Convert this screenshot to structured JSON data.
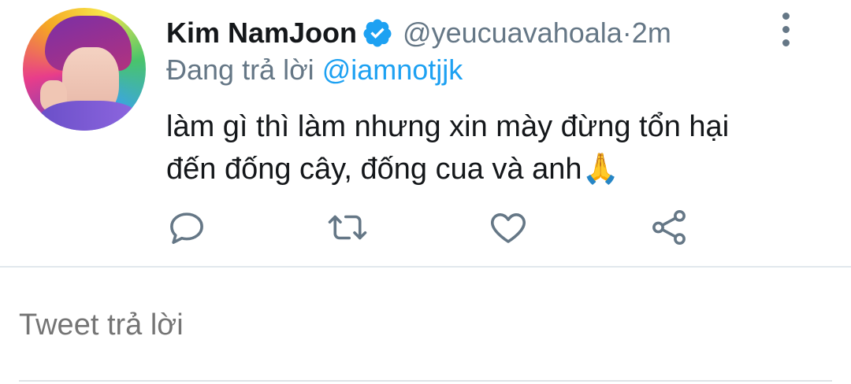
{
  "tweet": {
    "author_name": "Kim NamJoon",
    "verified": true,
    "handle": "@yeucuavahoala",
    "separator": " · ",
    "time": "2m",
    "reply_prefix": "Đang trả lời ",
    "reply_to": "@iamnotjjk",
    "text_line1": "làm gì thì làm nhưng xin mày đừng tổn hại",
    "text_line2": "đến đống cây, đống cua và anh",
    "emoji": "🙏"
  },
  "actions": {
    "icons": [
      "reply-icon",
      "retweet-icon",
      "like-icon",
      "share-icon"
    ]
  },
  "composer": {
    "placeholder": "Tweet trả lời"
  },
  "colors": {
    "accent": "#1da1f2",
    "text": "#14171a",
    "muted": "#657786",
    "divider": "#e1e8ed"
  }
}
